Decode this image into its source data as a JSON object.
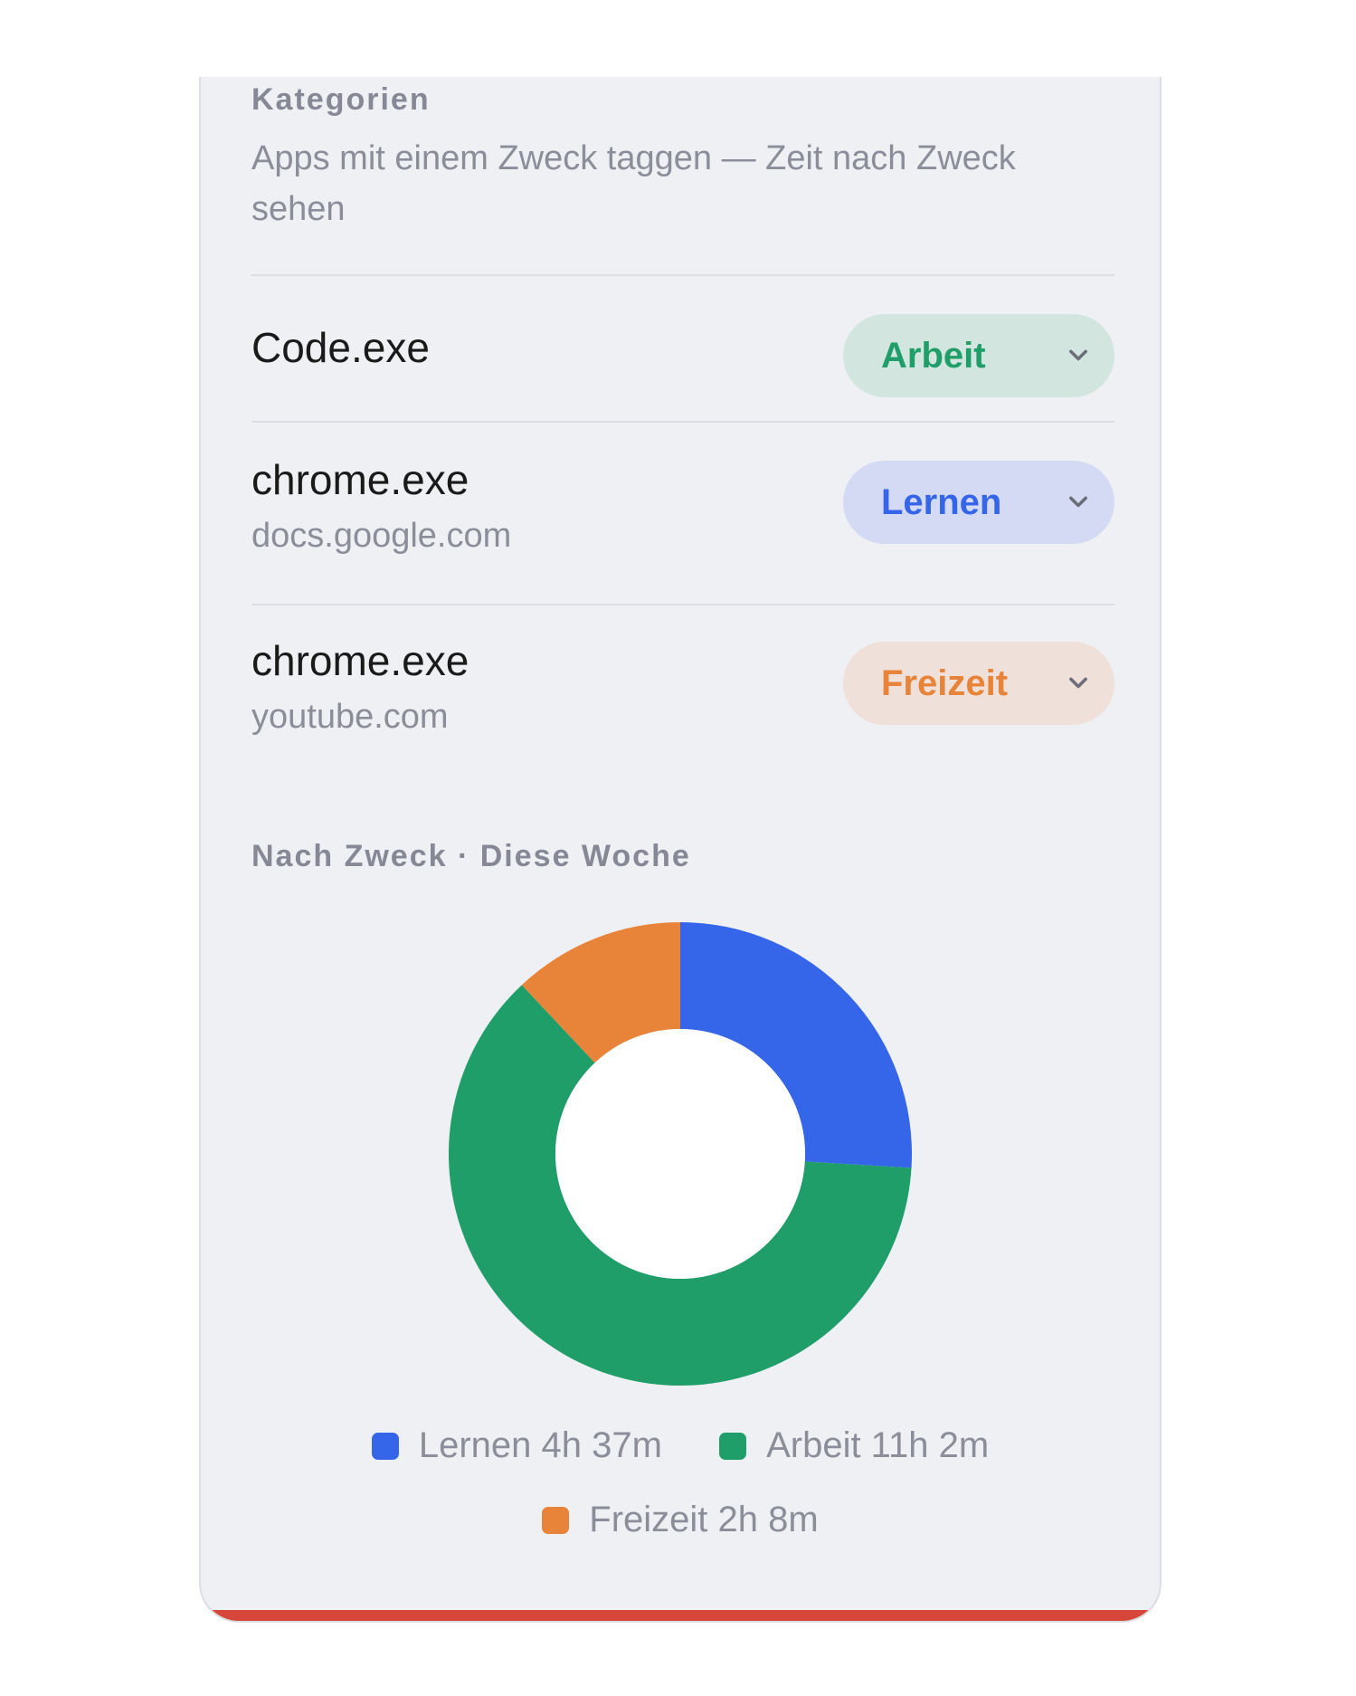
{
  "categories_panel": {
    "title": "Kategorien",
    "subtitle": "Apps mit einem Zweck taggen — Zeit nach Zweck sehen"
  },
  "apps": [
    {
      "name": "Code.exe",
      "domain": "",
      "category": "Arbeit",
      "color": "#1f9e69",
      "pill_bg": "#d2e6df"
    },
    {
      "name": "chrome.exe",
      "domain": "docs.google.com",
      "category": "Lernen",
      "color": "#3565e8",
      "pill_bg": "#d4daf3"
    },
    {
      "name": "chrome.exe",
      "domain": "youtube.com",
      "category": "Freizeit",
      "color": "#e8843a",
      "pill_bg": "#efe0d9"
    }
  ],
  "chart_section": {
    "title": "Nach Zweck · Diese Woche"
  },
  "chart_data": {
    "type": "pie",
    "donut": true,
    "categories": [
      "Lernen",
      "Arbeit",
      "Freizeit"
    ],
    "values_minutes": [
      277,
      662,
      128
    ],
    "colors": [
      "#3565e8",
      "#1f9e69",
      "#e8843a"
    ],
    "legend": [
      {
        "label": "Lernen 4h 37m",
        "color": "#3565e8"
      },
      {
        "label": "Arbeit 11h 2m",
        "color": "#1f9e69"
      },
      {
        "label": "Freizeit 2h 8m",
        "color": "#e8843a"
      }
    ],
    "legend_position": "bottom"
  }
}
